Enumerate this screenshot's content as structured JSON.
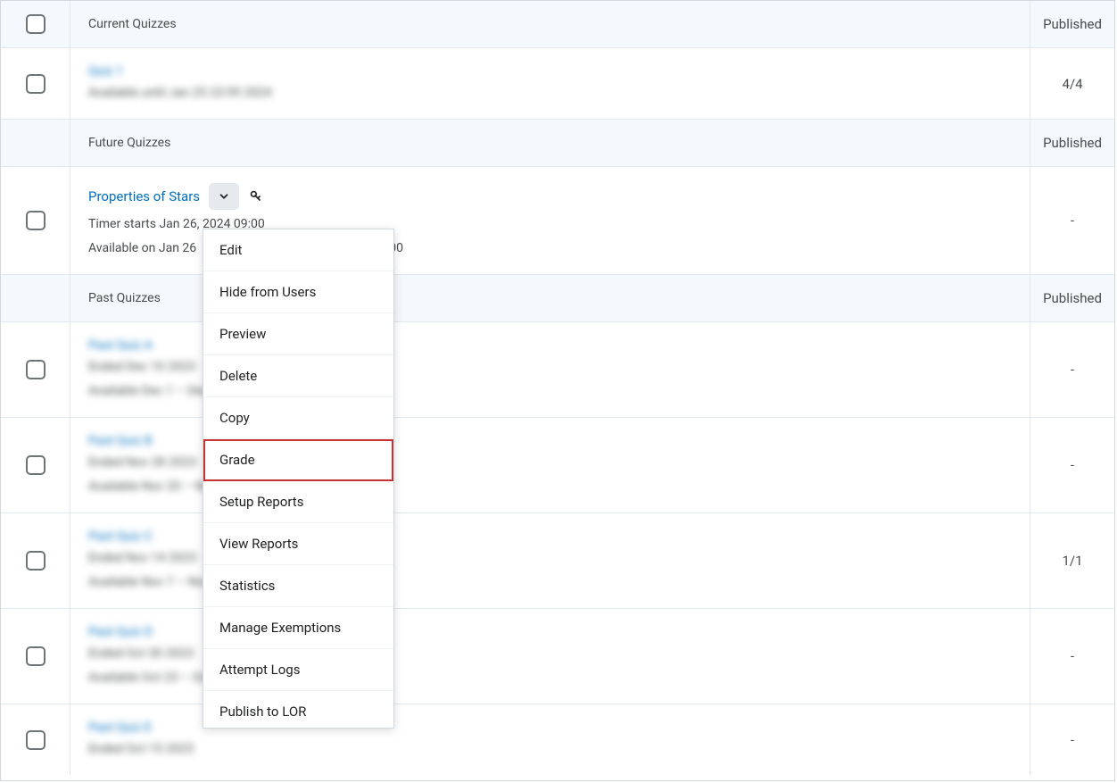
{
  "sections": {
    "current": {
      "title": "Current Quizzes",
      "right": "Published"
    },
    "future": {
      "title": "Future Quizzes",
      "right": "Published"
    },
    "past": {
      "title": "Past Quizzes",
      "right": "Published"
    }
  },
  "current_quiz": {
    "title_placeholder": "Quiz 1",
    "subtext_placeholder": "Available until Jan 25 23:59 2024",
    "right": "4/4"
  },
  "future_quiz": {
    "title": "Properties of Stars",
    "line1": "Timer starts Jan 26, 2024 09:00",
    "line2_prefix": "Available on Jan 26",
    "line2_suffix": "18:00",
    "right": "-"
  },
  "past_quizzes": [
    {
      "title_placeholder": "Past Quiz A",
      "line1_placeholder": "Ended Dec 10 2023",
      "line2_placeholder": "Available Dec 1 – Dec 10 2023 at 23:59",
      "right": "-"
    },
    {
      "title_placeholder": "Past Quiz B",
      "line1_placeholder": "Ended Nov 28 2023",
      "line2_placeholder": "Available Nov 20 – Nov 28 2023 at 23:59",
      "right": "-"
    },
    {
      "title_placeholder": "Past Quiz C",
      "line1_placeholder": "Ended Nov 14 2023",
      "line2_placeholder": "Available Nov 7 – Nov 14 2023 at 23:59",
      "right": "1/1"
    },
    {
      "title_placeholder": "Past Quiz D",
      "line1_placeholder": "Ended Oct 30 2023",
      "line2_placeholder": "Available Oct 23 – Oct 30 2023 at 23:59",
      "right": "-"
    },
    {
      "title_placeholder": "Past Quiz E",
      "line1_placeholder": "Ended Oct 15 2023",
      "right": "-"
    }
  ],
  "dropdown": {
    "items": [
      "Edit",
      "Hide from Users",
      "Preview",
      "Delete",
      "Copy",
      "Grade",
      "Setup Reports",
      "View Reports",
      "Statistics",
      "Manage Exemptions",
      "Attempt Logs",
      "Publish to LOR"
    ],
    "highlight_index": 5
  }
}
